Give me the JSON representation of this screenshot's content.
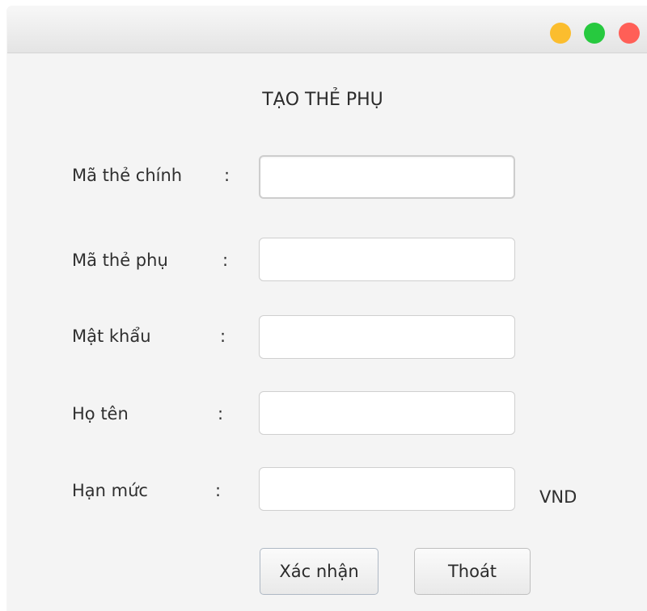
{
  "window": {
    "title": "",
    "controls": [
      "minimize",
      "maximize",
      "close"
    ],
    "colors": {
      "minimize": "#fbbd2e",
      "maximize": "#27c93f",
      "close": "#ff5f57"
    }
  },
  "form": {
    "title": "TẠO THẺ PHỤ",
    "fields": [
      {
        "label": "Mã thẻ chính",
        "colon": ":",
        "value": "",
        "placeholder": ""
      },
      {
        "label": "Mã thẻ phụ",
        "colon": ":",
        "value": "",
        "placeholder": ""
      },
      {
        "label": "Mật khẩu",
        "colon": ":",
        "value": "",
        "placeholder": ""
      },
      {
        "label": "Họ tên",
        "colon": ":",
        "value": "",
        "placeholder": ""
      },
      {
        "label": "Hạn mức",
        "colon": ":",
        "value": "",
        "placeholder": "",
        "unit": "VND"
      }
    ],
    "buttons": {
      "confirm": "Xác nhận",
      "exit": "Thoát"
    }
  }
}
